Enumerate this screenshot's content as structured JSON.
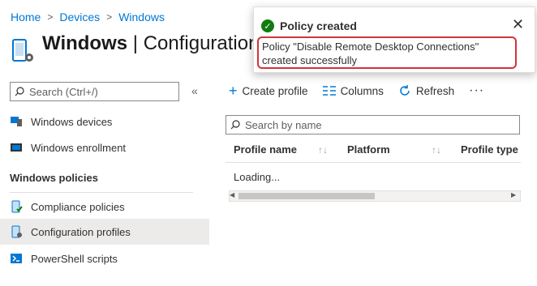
{
  "breadcrumb": {
    "items": [
      "Home",
      "Devices",
      "Windows"
    ],
    "separator": ">"
  },
  "page": {
    "title_bold": "Windows",
    "title_sep": " | ",
    "title_rest": "Configuration"
  },
  "sidebar": {
    "search_placeholder": "Search (Ctrl+/)",
    "collapse": "«",
    "items": [
      {
        "label": "Windows devices",
        "icon": "windows-devices-icon"
      },
      {
        "label": "Windows enrollment",
        "icon": "windows-enrollment-icon"
      }
    ],
    "group_header": "Windows policies",
    "policy_items": [
      {
        "label": "Compliance policies",
        "icon": "compliance-icon",
        "selected": false
      },
      {
        "label": "Configuration profiles",
        "icon": "configuration-profiles-icon",
        "selected": true
      },
      {
        "label": "PowerShell scripts",
        "icon": "powershell-icon",
        "selected": false
      }
    ]
  },
  "toolbar": {
    "create": "Create profile",
    "columns": "Columns",
    "refresh": "Refresh",
    "more": "···"
  },
  "filter": {
    "placeholder": "Search by name"
  },
  "table": {
    "columns": [
      "Profile name",
      "Platform",
      "Profile type"
    ],
    "status": "Loading..."
  },
  "toast": {
    "title": "Policy created",
    "message": "Policy \"Disable Remote Desktop Connections\" created successfully",
    "close": "✕"
  },
  "colors": {
    "accent": "#0078d4",
    "success": "#107c10",
    "highlight": "#d13438"
  }
}
